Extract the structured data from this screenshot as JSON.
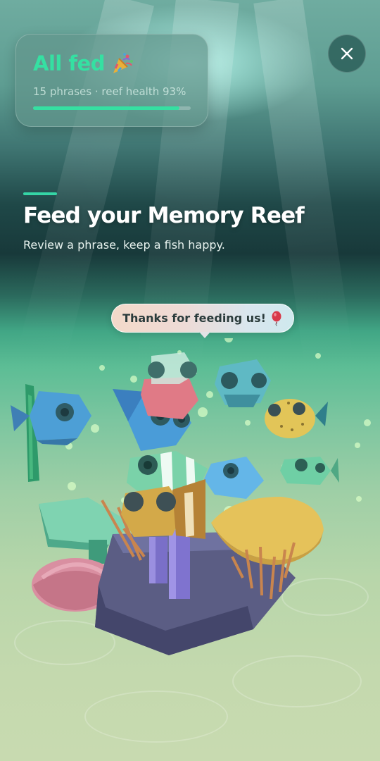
{
  "status_card": {
    "title": "All fed",
    "title_icon": "party-popper-icon",
    "summary": "15 phrases · reef health 93%",
    "reef_health": 0.93,
    "accent_color": "#35e0a2"
  },
  "close_button": {
    "icon": "close-icon"
  },
  "intro": {
    "headline": "Feed your Memory Reef",
    "subline": "Review a phrase, keep a fish happy."
  },
  "speech_bubble": {
    "text": "Thanks for feeding us!",
    "icon": "balloon-icon"
  }
}
